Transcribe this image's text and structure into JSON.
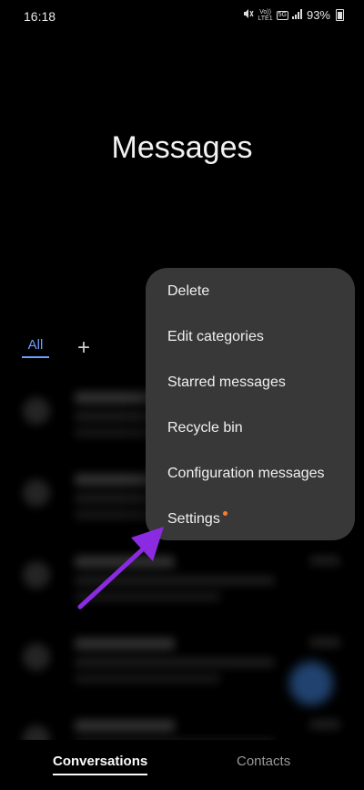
{
  "status": {
    "time": "16:18",
    "volte": "Vo))\nLTE1",
    "network": "5G",
    "battery": "93%"
  },
  "page": {
    "title": "Messages"
  },
  "tabs": {
    "all_label": "All",
    "add_label": "+"
  },
  "menu": {
    "items": [
      {
        "label": "Delete"
      },
      {
        "label": "Edit categories"
      },
      {
        "label": "Starred messages"
      },
      {
        "label": "Recycle bin"
      },
      {
        "label": "Configuration messages"
      },
      {
        "label": "Settings"
      }
    ]
  },
  "bottom_nav": {
    "conversations": "Conversations",
    "contacts": "Contacts"
  },
  "colors": {
    "accent": "#6f9cff",
    "arrow": "#8a2be2",
    "badge_dot": "#ff7a30"
  }
}
